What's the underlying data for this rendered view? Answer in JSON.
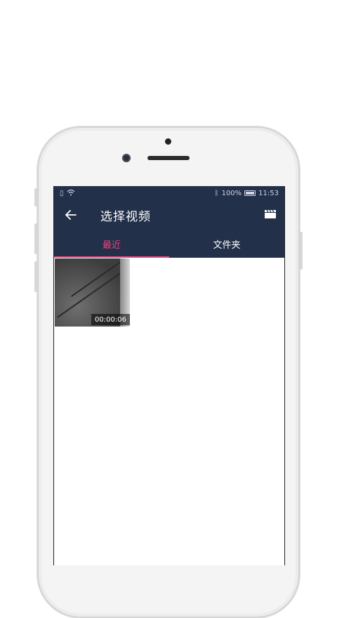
{
  "status_bar": {
    "battery_text": "100%",
    "time": "11:53"
  },
  "app_bar": {
    "title": "选择视频",
    "back_icon": "arrow-left-icon",
    "action_icon": "clapperboard-icon"
  },
  "tabs": [
    {
      "label": "最近",
      "active": true
    },
    {
      "label": "文件夹",
      "active": false
    }
  ],
  "videos": [
    {
      "duration": "00:00:06"
    }
  ],
  "colors": {
    "header_bg": "#23304a",
    "accent": "#e8457b"
  }
}
